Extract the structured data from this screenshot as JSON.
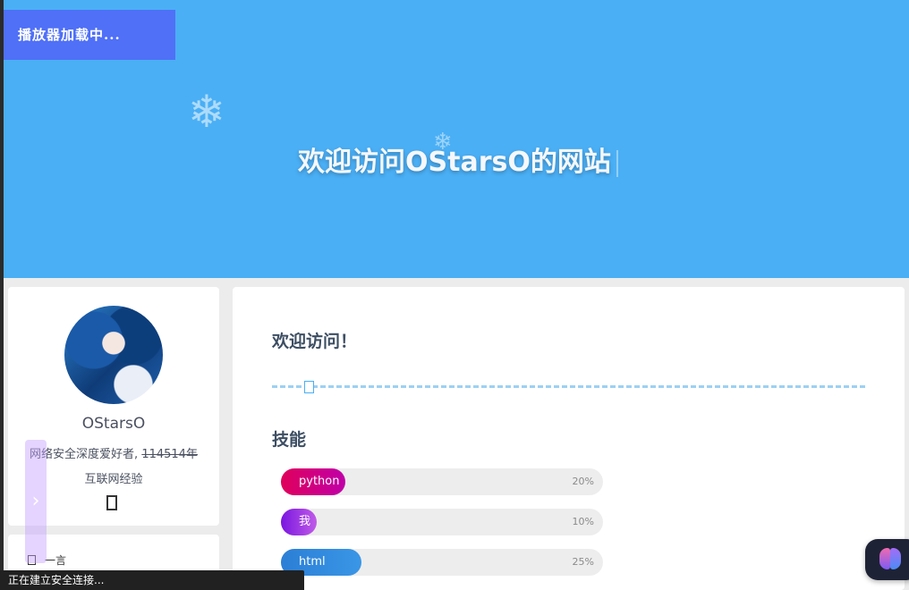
{
  "player": {
    "status": "播放器加载中..."
  },
  "hero": {
    "title": "欢迎访问OStarsO的网站"
  },
  "profile": {
    "name": "OStarsO",
    "desc_prefix": "网络安全深度爱好者, ",
    "desc_strike": "114514年",
    "desc_suffix": "互联网经验"
  },
  "sidebar": {
    "toggle_icon": "›",
    "quote_label": "一言"
  },
  "main": {
    "welcome": "欢迎访问！",
    "skills_title": "技能",
    "skills": [
      {
        "name": "python",
        "percent": 20,
        "percent_label": "20%",
        "color_start": "#e0005a",
        "color_end": "#c000a8"
      },
      {
        "name": "我",
        "percent": 10,
        "percent_label": "10%",
        "color_start": "#7a16e0",
        "color_end": "#c05be8"
      },
      {
        "name": "html",
        "percent": 25,
        "percent_label": "25%",
        "color_start": "#2b7fd6",
        "color_end": "#3a96e6"
      }
    ]
  },
  "status_bar": {
    "text": "正在建立安全连接..."
  },
  "colors": {
    "hero": "#4aaff5",
    "player": "#4f70f7",
    "heading": "#3d4e63"
  }
}
